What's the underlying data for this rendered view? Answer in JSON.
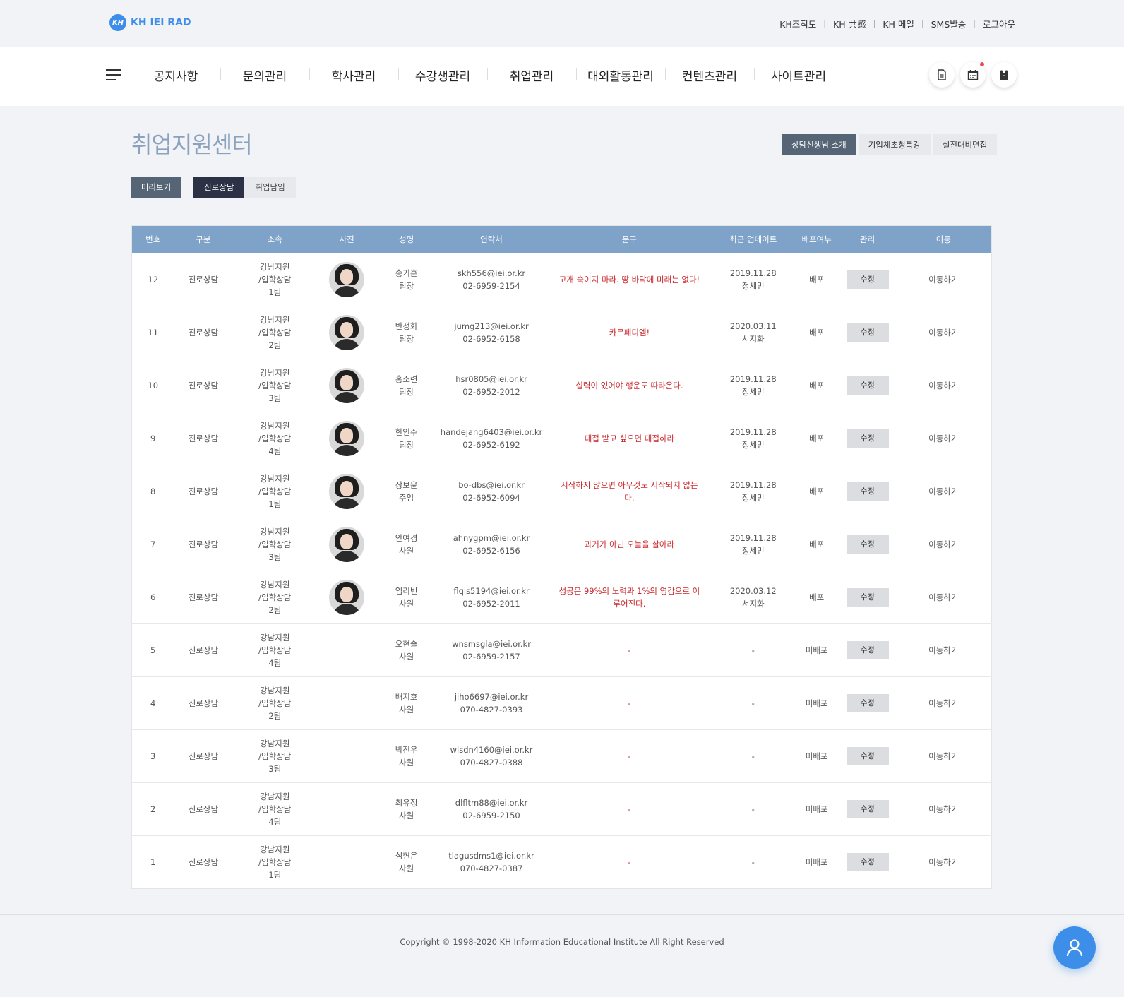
{
  "brand": {
    "mark": "KH",
    "name": "KH IEI RAD",
    "color": "#3d8ee8"
  },
  "util_links": [
    "KH조직도",
    "KH 共感",
    "KH 메일",
    "SMS발송",
    "로그아웃"
  ],
  "gnb": {
    "menu": [
      "공지사항",
      "문의관리",
      "학사관리",
      "수강생관리",
      "취업관리",
      "대외활동관리",
      "컨텐츠관리",
      "사이트관리"
    ],
    "icons": [
      "document-icon",
      "calendar-icon",
      "people-icon"
    ]
  },
  "page": {
    "title": "취업지원센터",
    "right_tabs": [
      "상담선생님 소개",
      "기업체초청특강",
      "실전대비면접"
    ],
    "preview_label": "미리보기",
    "sub_tabs": [
      "진로상담",
      "취업담임"
    ]
  },
  "table": {
    "headers": [
      "번호",
      "구분",
      "소속",
      "사진",
      "성명",
      "연락처",
      "문구",
      "최근 업데이트",
      "배포여부",
      "관리",
      "이동"
    ],
    "rows": [
      {
        "no": "12",
        "type": "진로상담",
        "org1": "강남지원",
        "org2": "/입학상담",
        "org3": "1팀",
        "photo": true,
        "name": "송기훈",
        "title": "팀장",
        "email": "skh556@iei.or.kr",
        "phone": "02-6959-2154",
        "phrase": "고개 숙이지 마라. 땅 바닥에 미래는 없다!",
        "date": "2019.11.28",
        "editor": "정세민",
        "deploy": "배포",
        "edit": "수정",
        "move": "이동하기"
      },
      {
        "no": "11",
        "type": "진로상담",
        "org1": "강남지원",
        "org2": "/입학상담",
        "org3": "2팀",
        "photo": true,
        "name": "반정화",
        "title": "팀장",
        "email": "jumg213@iei.or.kr",
        "phone": "02-6952-6158",
        "phrase": "카르페디엠!",
        "date": "2020.03.11",
        "editor": "서지화",
        "deploy": "배포",
        "edit": "수정",
        "move": "이동하기"
      },
      {
        "no": "10",
        "type": "진로상담",
        "org1": "강남지원",
        "org2": "/입학상담",
        "org3": "3팀",
        "photo": true,
        "name": "홍소련",
        "title": "팀장",
        "email": "hsr0805@iei.or.kr",
        "phone": "02-6952-2012",
        "phrase": "실력이 있어야 행운도 따라온다.",
        "date": "2019.11.28",
        "editor": "정세민",
        "deploy": "배포",
        "edit": "수정",
        "move": "이동하기"
      },
      {
        "no": "9",
        "type": "진로상담",
        "org1": "강남지원",
        "org2": "/입학상담",
        "org3": "4팀",
        "photo": true,
        "name": "한인주",
        "title": "팀장",
        "email": "handejang6403@iei.or.kr",
        "phone": "02-6952-6192",
        "phrase": "대접 받고 싶으면 대접하라",
        "date": "2019.11.28",
        "editor": "정세민",
        "deploy": "배포",
        "edit": "수정",
        "move": "이동하기"
      },
      {
        "no": "8",
        "type": "진로상담",
        "org1": "강남지원",
        "org2": "/입학상담",
        "org3": "1팀",
        "photo": true,
        "name": "장보윤",
        "title": "주임",
        "email": "bo-dbs@iei.or.kr",
        "phone": "02-6952-6094",
        "phrase": "시작하지 않으면 아무것도 시작되지 않는다.",
        "date": "2019.11.28",
        "editor": "정세민",
        "deploy": "배포",
        "edit": "수정",
        "move": "이동하기"
      },
      {
        "no": "7",
        "type": "진로상담",
        "org1": "강남지원",
        "org2": "/입학상담",
        "org3": "3팀",
        "photo": true,
        "name": "안여경",
        "title": "사원",
        "email": "ahnygpm@iei.or.kr",
        "phone": "02-6952-6156",
        "phrase": "과거가 아닌 오늘을 살아라",
        "date": "2019.11.28",
        "editor": "정세민",
        "deploy": "배포",
        "edit": "수정",
        "move": "이동하기"
      },
      {
        "no": "6",
        "type": "진로상담",
        "org1": "강남지원",
        "org2": "/입학상담",
        "org3": "2팀",
        "photo": true,
        "name": "임리빈",
        "title": "사원",
        "email": "flqls5194@iei.or.kr",
        "phone": "02-6952-2011",
        "phrase": "성공은 99%의 노력과 1%의 영감으로 이루어진다.",
        "date": "2020.03.12",
        "editor": "서지화",
        "deploy": "배포",
        "edit": "수정",
        "move": "이동하기"
      },
      {
        "no": "5",
        "type": "진로상담",
        "org1": "강남지원",
        "org2": "/입학상담",
        "org3": "4팀",
        "photo": false,
        "name": "오현솔",
        "title": "사원",
        "email": "wnsmsgla@iei.or.kr",
        "phone": "02-6959-2157",
        "phrase": "-",
        "date": "-",
        "editor": "",
        "deploy": "미배포",
        "edit": "수정",
        "move": "이동하기"
      },
      {
        "no": "4",
        "type": "진로상담",
        "org1": "강남지원",
        "org2": "/입학상담",
        "org3": "2팀",
        "photo": false,
        "name": "배지호",
        "title": "사원",
        "email": "jiho6697@iei.or.kr",
        "phone": "070-4827-0393",
        "phrase": "-",
        "date": "-",
        "editor": "",
        "deploy": "미배포",
        "edit": "수정",
        "move": "이동하기"
      },
      {
        "no": "3",
        "type": "진로상담",
        "org1": "강남지원",
        "org2": "/입학상담",
        "org3": "3팀",
        "photo": false,
        "name": "박진우",
        "title": "사원",
        "email": "wlsdn4160@iei.or.kr",
        "phone": "070-4827-0388",
        "phrase": "-",
        "date": "-",
        "editor": "",
        "deploy": "미배포",
        "edit": "수정",
        "move": "이동하기"
      },
      {
        "no": "2",
        "type": "진로상담",
        "org1": "강남지원",
        "org2": "/입학상담",
        "org3": "4팀",
        "photo": false,
        "name": "최유정",
        "title": "사원",
        "email": "dlfltm88@iei.or.kr",
        "phone": "02-6959-2150",
        "phrase": "-",
        "date": "-",
        "editor": "",
        "deploy": "미배포",
        "edit": "수정",
        "move": "이동하기"
      },
      {
        "no": "1",
        "type": "진로상담",
        "org1": "강남지원",
        "org2": "/입학상담",
        "org3": "1팀",
        "photo": false,
        "name": "심현은",
        "title": "사원",
        "email": "tlagusdms1@iei.or.kr",
        "phone": "070-4827-0387",
        "phrase": "-",
        "date": "-",
        "editor": "",
        "deploy": "미배포",
        "edit": "수정",
        "move": "이동하기"
      }
    ]
  },
  "footer": {
    "copyright": "Copyright © 1998-2020 KH Information Educational Institute All Right Reserved"
  },
  "colors": {
    "header_bg": "#7fa2c8",
    "accent": "#3d8ee8",
    "phrase": "#c8262b",
    "active_tab": "#2d3146"
  }
}
